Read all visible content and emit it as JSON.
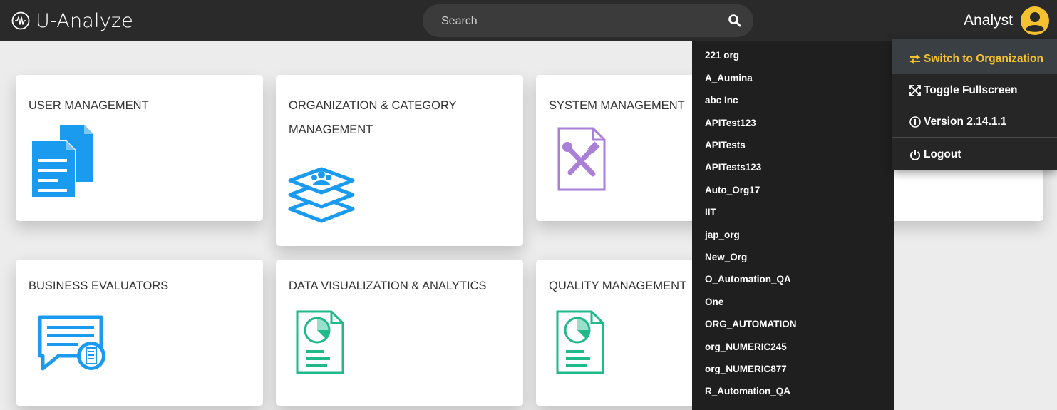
{
  "app": {
    "title": "U-Analyze"
  },
  "search": {
    "placeholder": "Search"
  },
  "user": {
    "name": "Analyst"
  },
  "cards": [
    {
      "title": "USER MANAGEMENT",
      "icon": "documents-icon"
    },
    {
      "title": "ORGANIZATION & CATEGORY MANAGEMENT",
      "icon": "layers-users-icon"
    },
    {
      "title": "SYSTEM MANAGEMENT",
      "icon": "tools-document-icon"
    },
    {
      "title": "BUSINESS EVALUATORS",
      "icon": "chat-form-icon"
    },
    {
      "title": "DATA VISUALIZATION & ANALYTICS",
      "icon": "chart-document-icon"
    },
    {
      "title": "QUALITY MANAGEMENT",
      "icon": "chart-document-icon"
    }
  ],
  "org_menu": {
    "items": [
      "221 org",
      "A_Aumina",
      "abc Inc",
      "APITest123",
      "APITests",
      "APITests123",
      "Auto_Org17",
      "IIT",
      "jap_org",
      "New_Org",
      "O_Automation_QA",
      "One",
      "ORG_AUTOMATION",
      "org_NUMERIC245",
      "org_NUMERIC877",
      "R_Automation_QA"
    ]
  },
  "user_menu": {
    "switch_org": "Switch to Organization",
    "toggle_fullscreen": "Toggle Fullscreen",
    "version": "Version 2.14.1.1",
    "logout": "Logout"
  },
  "colors": {
    "topbar": "#2a2a2a",
    "accent_yellow": "#f5c12e",
    "blue_icon": "#1a9bf0",
    "purple_icon": "#a97fd8",
    "green_icon": "#1fb98a"
  }
}
